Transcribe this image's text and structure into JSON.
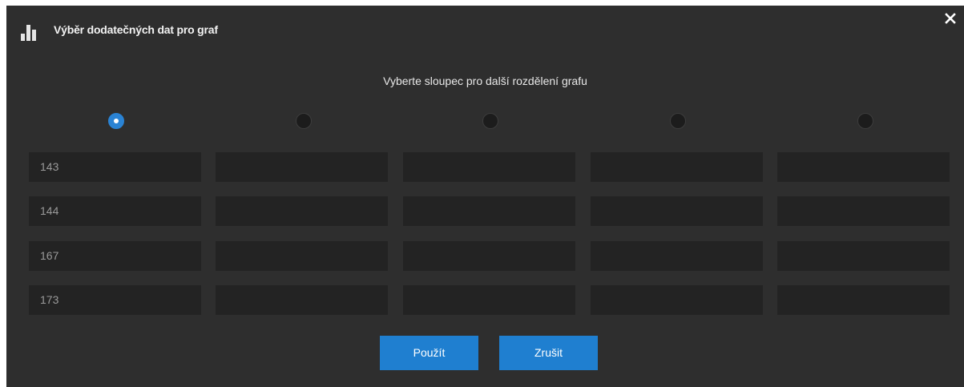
{
  "dialog": {
    "title": "Výběr dodatečných dat pro graf",
    "close_label": "✕",
    "subtitle": "Vyberte sloupec pro další rozdělení grafu"
  },
  "radios": [
    {
      "selected": true
    },
    {
      "selected": false
    },
    {
      "selected": false
    },
    {
      "selected": false
    },
    {
      "selected": false
    }
  ],
  "table": {
    "rows": [
      [
        "143",
        "",
        "",
        "",
        ""
      ],
      [
        "144",
        "",
        "",
        "",
        ""
      ],
      [
        "167",
        "",
        "",
        "",
        ""
      ],
      [
        "173",
        "",
        "",
        "",
        ""
      ]
    ]
  },
  "buttons": {
    "apply_label": "Použít",
    "cancel_label": "Zrušit"
  },
  "colors": {
    "background": "#2e2e2e",
    "cell": "#232323",
    "accent": "#1f7fd0"
  },
  "icons": {
    "title": "bar-chart-icon",
    "close": "close-icon"
  }
}
